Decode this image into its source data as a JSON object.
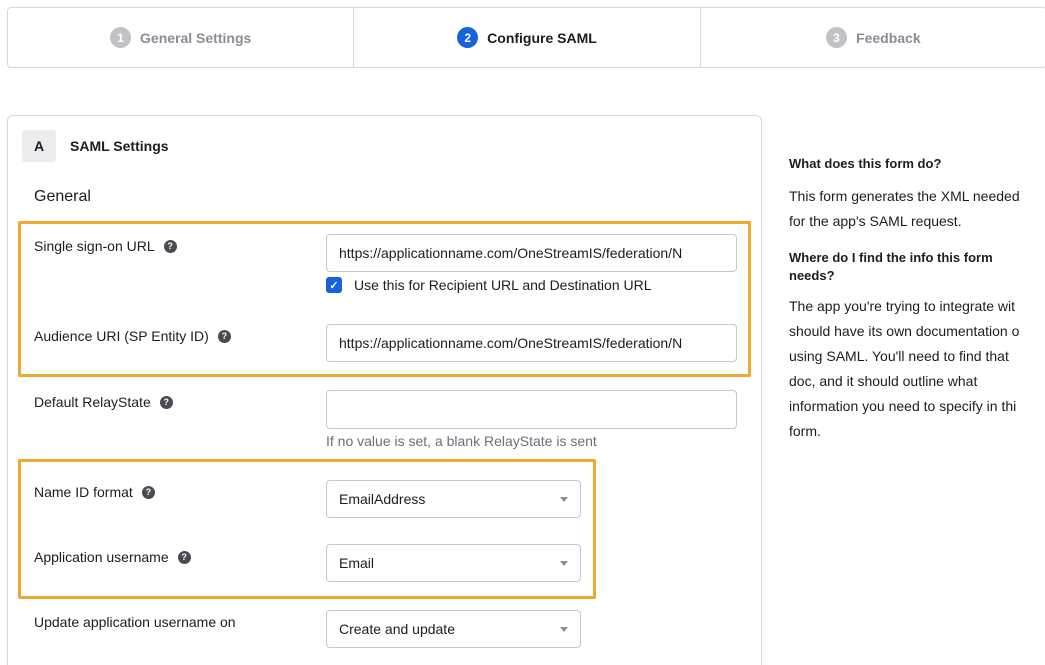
{
  "wizard": {
    "steps": [
      {
        "number": "1",
        "label": "General Settings"
      },
      {
        "number": "2",
        "label": "Configure SAML"
      },
      {
        "number": "3",
        "label": "Feedback"
      }
    ]
  },
  "section": {
    "letter": "A",
    "title": "SAML Settings",
    "group_title": "General"
  },
  "fields": {
    "sso_url": {
      "label": "Single sign-on URL",
      "value": "https://applicationname.com/OneStreamIS/federation/N"
    },
    "recipient_checkbox": {
      "label": "Use this for Recipient URL and Destination URL",
      "checked": true
    },
    "audience_uri": {
      "label": "Audience URI (SP Entity ID)",
      "value": "https://applicationname.com/OneStreamIS/federation/N"
    },
    "relay_state": {
      "label": "Default RelayState",
      "value": "",
      "hint": "If no value is set, a blank RelayState is sent"
    },
    "name_id_format": {
      "label": "Name ID format",
      "value": "EmailAddress"
    },
    "app_username": {
      "label": "Application username",
      "value": "Email"
    },
    "update_username_on": {
      "label": "Update application username on",
      "value": "Create and update"
    }
  },
  "help_icon_glyph": "?",
  "checkmark_glyph": "✓",
  "side_help": {
    "q1": "What does this form do?",
    "a1_lines": [
      "This form generates the XML needed",
      "for the app's SAML request."
    ],
    "q2_lines": [
      "Where do I find the info this form",
      "needs?"
    ],
    "a2_lines": [
      "The app you're trying to integrate wit",
      "should have its own documentation o",
      "using SAML. You'll need to find that",
      "doc, and it should outline what",
      "information you need to specify in thi",
      "form."
    ]
  },
  "colors": {
    "accent": "#1662dd",
    "highlight": "#f0a830",
    "border": "#d7d7dc"
  }
}
